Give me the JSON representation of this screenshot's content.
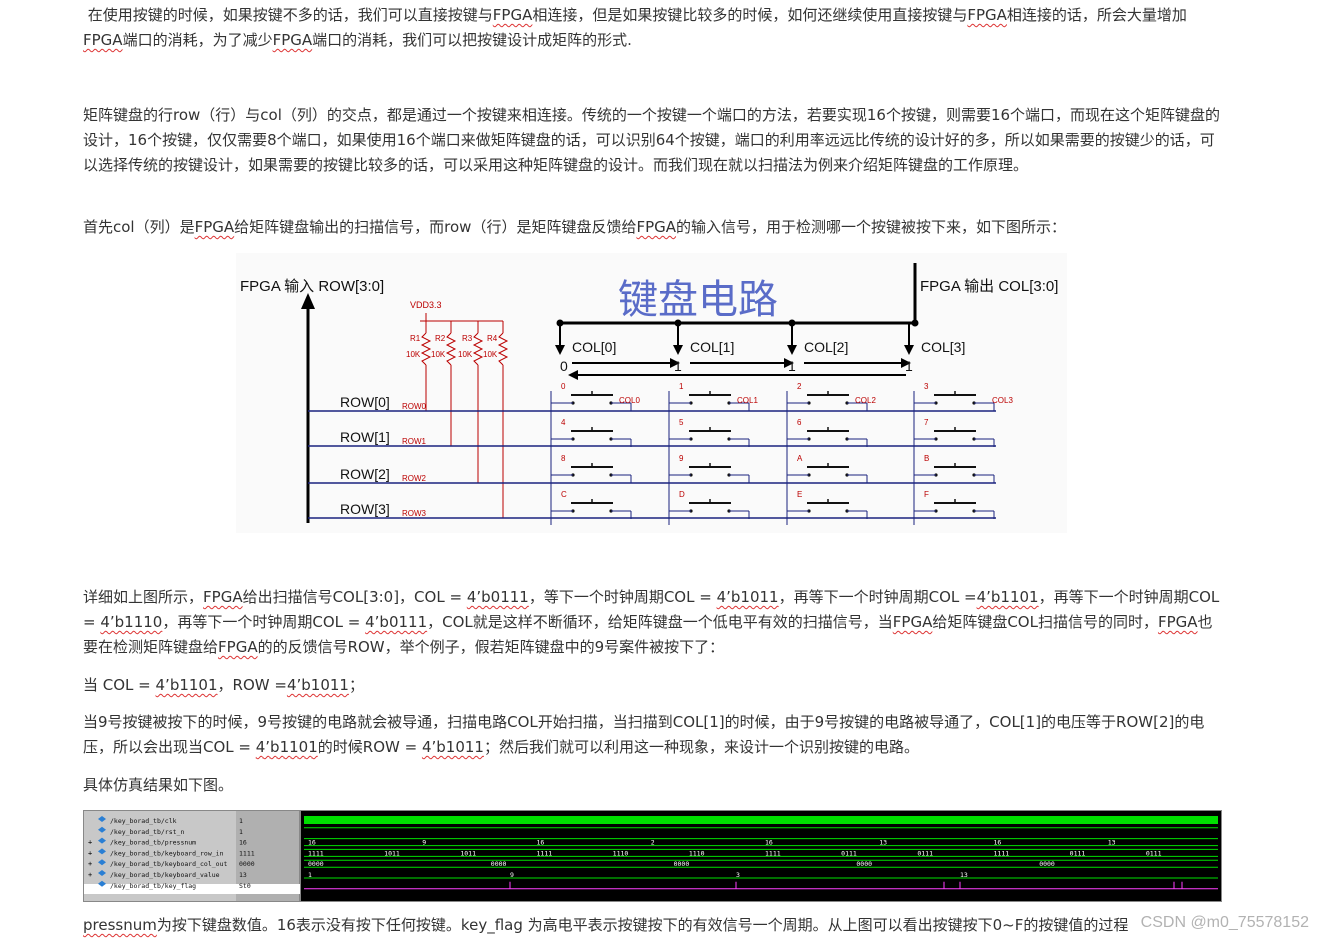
{
  "paragraphs": {
    "p1": [
      " 在使用按键的时候，如果按键不多的话，我们可以直接按键与",
      "FPGA",
      "相连接，但是如果按键比较多的时候，如何还继续使用直接按键与",
      "FPGA",
      "相连接的话，所会大量增加",
      "FPGA",
      "端口的消耗，为了减少",
      "FPGA",
      "端口的消耗，我们可以把按键设计成矩阵的形式."
    ],
    "p2": "矩阵键盘的行row（行）与col（列）的交点，都是通过一个按键来相连接。传统的一个按键一个端口的方法，若要实现16个按键，则需要16个端口，而现在这个矩阵键盘的设计，16个按键，仅仅需要8个端口，如果使用16个端口来做矩阵键盘的话，可以识别64个按键，端口的利用率远远比传统的设计好的多，所以如果需要的按键少的话，可以选择传统的按键设计，如果需要的按键比较多的话，可以采用这种矩阵键盘的设计。而我们现在就以扫描法为例来介绍矩阵键盘的工作原理。",
    "p3": [
      "首先col（列）是",
      "FPGA",
      "给矩阵键盘输出的扫描信号，而row（行）是矩阵键盘反馈给",
      "FPGA",
      "的输入信号，用于检测哪一个按键被按下来，如下图所示："
    ],
    "p4": [
      "详细如上图所示，",
      "FPGA",
      "给出扫描信号COL[3:0]，COL = ",
      "4’b0111",
      "，等下一个时钟周期COL = ",
      "4’b1011",
      "，再等下一个时钟周期COL =",
      "4’b1101",
      "，再等下一个时钟周期COL = ",
      "4’b1110",
      "，再等下一个时钟周期COL = ",
      "4’b0111",
      "，COL就是这样不断循环，给矩阵键盘一个低电平有效的扫描信号，当",
      "FPGA",
      "给矩阵键盘COL扫描信号的同时，",
      "FPGA",
      "也要在检测矩阵键盘给",
      "FPGA",
      "的的反馈信号ROW，举个例子，假若矩阵键盘中的9号案件被按下了："
    ],
    "p5": [
      "当 COL = ",
      "4’b1101",
      "，ROW =",
      "4’b1011",
      "；"
    ],
    "p6": [
      "当9号按键被按下的时候，9号按键的电路就会被导通，扫描电路COL开始扫描，当扫描到COL[1]的时候，由于9号按键的电路被导通了，COL[1]的电压等于ROW[2]的电压，所以会出现当COL = ",
      "4’b1101",
      "的时候ROW = ",
      "4’b1011",
      "；然后我们就可以利用这一种现象，来设计一个识别按键的电路。"
    ],
    "p7": "具体仿真结果如下图。",
    "p8": [
      "pressnum",
      "为按下键盘数值。16表示没有按下任何按键。key_flag 为高电平表示按键按下的有效信号一个周期。从上图可以看出按键按下0~F的按键值的过程"
    ]
  },
  "diagram": {
    "title": "键盘电路",
    "input_label": "FPGA 输入 ROW[3:0]",
    "output_label": "FPGA 输出 COL[3:0]",
    "vdd": "VDD3.3",
    "resistors": [
      "R1",
      "R2",
      "R3",
      "R4"
    ],
    "resistor_value": "10K",
    "col_labels": [
      "COL[0]",
      "COL[1]",
      "COL[2]",
      "COL[3]"
    ],
    "scan_bits": [
      "0",
      "1",
      "1",
      "1"
    ],
    "row_labels": [
      "ROW[0]",
      "ROW[1]",
      "ROW[2]",
      "ROW[3]"
    ],
    "row_net_labels": [
      "ROW0",
      "ROW1",
      "ROW2",
      "ROW3"
    ],
    "col_net_labels": [
      "COL0",
      "COL1",
      "COL2",
      "COL3"
    ],
    "keys": [
      [
        "0",
        "1",
        "2",
        "3"
      ],
      [
        "4",
        "5",
        "6",
        "7"
      ],
      [
        "8",
        "9",
        "A",
        "B"
      ],
      [
        "C",
        "D",
        "E",
        "F"
      ]
    ]
  },
  "simulation": {
    "signals": [
      {
        "name": "/key_borad_tb/clk",
        "value": "1",
        "expand": false
      },
      {
        "name": "/key_borad_tb/rst_n",
        "value": "1",
        "expand": false
      },
      {
        "name": "/key_borad_tb/pressnum",
        "value": "16",
        "expand": true
      },
      {
        "name": "/key_borad_tb/keyboard_row_in",
        "value": "1111",
        "expand": true
      },
      {
        "name": "/key_borad_tb/keyboard_col_out",
        "value": "0000",
        "expand": true
      },
      {
        "name": "/key_borad_tb/keyboard_value",
        "value": "13",
        "expand": true
      },
      {
        "name": "/key_borad_tb/key_flag",
        "value": "St0",
        "expand": false
      }
    ],
    "pressnum_marks": [
      "16",
      "9",
      "16",
      "2",
      "16",
      "13",
      "16",
      "13"
    ],
    "row_marks": [
      "1111",
      "1011",
      "1011",
      "1111",
      "1110",
      "1110",
      "1111",
      "0111",
      "0111",
      "1111",
      "0111",
      "0111"
    ],
    "col_marks": [
      "0000",
      "0000",
      "0000",
      "0000",
      "0000"
    ],
    "value_marks": [
      "1",
      "9",
      "3",
      "13"
    ]
  },
  "watermark": "CSDN @m0_75578152",
  "colors": {
    "link_underline": "#d33",
    "wave_green": "#00e000",
    "wave_flag": "#ff40ff"
  }
}
